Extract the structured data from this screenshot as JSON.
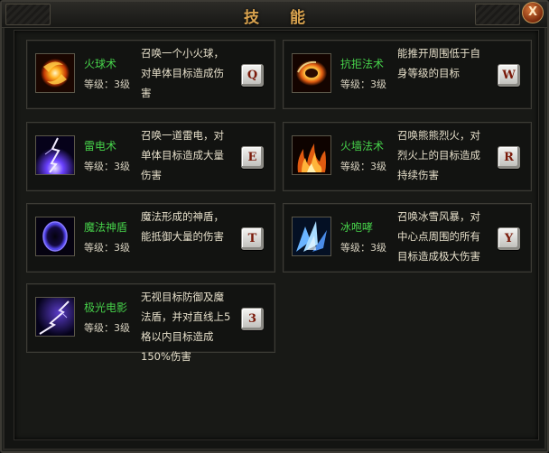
{
  "window": {
    "title": "技 能",
    "close_label": "X"
  },
  "skills": [
    {
      "name": "火球术",
      "level": "等级：3级",
      "desc": "召唤一个小火球，对单体目标造成伤害",
      "key": "Q",
      "icon": "fireball-icon"
    },
    {
      "name": "抗拒法术",
      "level": "等级：3级",
      "desc": "能推开周围低于自身等级的目标",
      "key": "W",
      "icon": "repel-icon"
    },
    {
      "name": "雷电术",
      "level": "等级：3级",
      "desc": "召唤一道雷电，对单体目标造成大量伤害",
      "key": "E",
      "icon": "lightning-icon"
    },
    {
      "name": "火墙法术",
      "level": "等级：3级",
      "desc": "召唤熊熊烈火，对烈火上的目标造成持续伤害",
      "key": "R",
      "icon": "firewall-icon"
    },
    {
      "name": "魔法神盾",
      "level": "等级：3级",
      "desc": "魔法形成的神盾，能抵御大量的伤害",
      "key": "T",
      "icon": "magic-shield-icon"
    },
    {
      "name": "冰咆哮",
      "level": "等级：3级",
      "desc": "召唤冰雪风暴，对中心点周围的所有目标造成极大伤害",
      "key": "Y",
      "icon": "ice-roar-icon"
    },
    {
      "name": "极光电影",
      "level": "等级：3级",
      "desc": "无视目标防御及魔法盾，并对直线上5格以内目标造成150%伤害",
      "key": "3",
      "icon": "aurora-lightning-icon"
    }
  ]
}
